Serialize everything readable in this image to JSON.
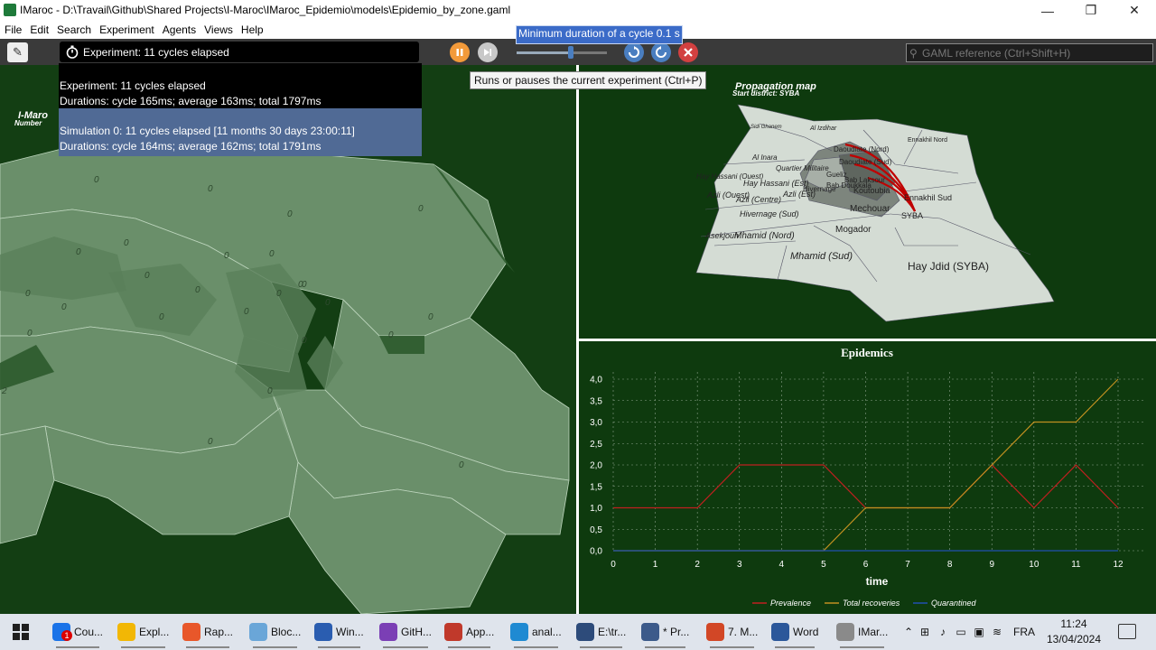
{
  "window": {
    "title": "IMaroc - D:\\Travail\\Github\\Shared Projects\\I-Maroc\\IMaroc_Epidemio\\models\\Epidemio_by_zone.gaml",
    "minimize": "—",
    "restore": "❐",
    "close": "✕"
  },
  "menu": [
    "File",
    "Edit",
    "Search",
    "Experiment",
    "Agents",
    "Views",
    "Help"
  ],
  "toolbar": {
    "experiment_status": "Experiment: 11 cycles elapsed",
    "slider_tooltip": "Minimum duration of a cycle 0.1 s",
    "slider_value": 0.6,
    "search_placeholder": "GAML reference (Ctrl+Shift+H)",
    "pause_tooltip": "Runs or pauses the current experiment (Ctrl+P)"
  },
  "status_dropdown": [
    {
      "line1": "Experiment: 11 cycles elapsed",
      "line2": "Durations: cycle 165ms; average 163ms; total 1797ms",
      "selected": false
    },
    {
      "line1": "Simulation 0: 11 cycles elapsed [11 months 30 days 23:00:11]",
      "line2": "Durations: cycle 164ms; average 162ms; total 1791ms",
      "selected": true
    }
  ],
  "left_view": {
    "title_fragment": "I-Maro",
    "subtitle_fragment": "Number",
    "zone_counts": [
      "0",
      "0",
      "0",
      "0",
      "0",
      "0",
      "0",
      "0",
      "0",
      "0",
      "0",
      "0",
      "0",
      "0",
      "0",
      "0",
      "0",
      "0",
      "0",
      "0",
      "0",
      "0",
      "2",
      "0",
      "0",
      "0"
    ]
  },
  "map": {
    "title": "Propagation map",
    "subtitle": "Start district: SYBA",
    "districts": [
      "Sidi Ghanem",
      "Al Izdihar",
      "Ennakhil Nord",
      "Daoudiate (Nord)",
      "Daoudiate (Sud)",
      "Al Inara",
      "Quartier Militaire",
      "Gueliz",
      "Hay Hassani (Ouest)",
      "Hay Hassani (Est)",
      "Bab Doukkala",
      "Bab Laksour",
      "Azli (Ouest)",
      "Azli (Est)",
      "Azli (Centre)",
      "Hivernage",
      "Koutoubia",
      "Ennakhil Sud",
      "Hivernage (Sud)",
      "Mechouar",
      "SYBA",
      "Asekjoun",
      "Mhamid (Nord)",
      "Mogador",
      "Mhamid (Sud)",
      "Hay Jdid (SYBA)"
    ]
  },
  "chart_data": {
    "type": "line",
    "title": "Epidemics",
    "xlabel": "time",
    "ylabel": "",
    "x": [
      0,
      1,
      2,
      3,
      4,
      5,
      6,
      7,
      8,
      9,
      10,
      11,
      12
    ],
    "xlim": [
      0,
      12
    ],
    "ylim": [
      0,
      4
    ],
    "yticks": [
      "0,0",
      "0,5",
      "1,0",
      "1,5",
      "2,0",
      "2,5",
      "3,0",
      "3,5",
      "4,0"
    ],
    "grid": true,
    "legend_position": "bottom",
    "series": [
      {
        "name": "Prevalence",
        "color": "#c02020",
        "values": [
          1,
          1,
          1,
          2,
          2,
          2,
          1,
          1,
          1,
          2,
          1,
          2,
          1
        ]
      },
      {
        "name": "Total recoveries",
        "color": "#c09020",
        "values": [
          0,
          0,
          0,
          0,
          0,
          0,
          1,
          1,
          1,
          2,
          3,
          3,
          4
        ]
      },
      {
        "name": "Quarantined",
        "color": "#2050b0",
        "values": [
          0,
          0,
          0,
          0,
          0,
          0,
          0,
          0,
          0,
          0,
          0,
          0,
          0
        ]
      }
    ]
  },
  "taskbar": {
    "apps": [
      {
        "label": "Cou...",
        "color": "#1a73e8",
        "badge": "1"
      },
      {
        "label": "Expl...",
        "color": "#f2b705"
      },
      {
        "label": "Rap...",
        "color": "#e8572a"
      },
      {
        "label": "Bloc...",
        "color": "#6aa6d8"
      },
      {
        "label": "Win...",
        "color": "#2a5db0"
      },
      {
        "label": "GitH...",
        "color": "#7b3fb5"
      },
      {
        "label": "App...",
        "color": "#c0392b"
      },
      {
        "label": "anal...",
        "color": "#1f8ad2"
      },
      {
        "label": "E:\\tr...",
        "color": "#2d4b7a"
      },
      {
        "label": "* Pr...",
        "color": "#3c5a8a"
      },
      {
        "label": "7. M...",
        "color": "#d24726"
      },
      {
        "label": "Word",
        "color": "#2b579a"
      },
      {
        "label": "IMar...",
        "color": "#8a8a8a"
      }
    ],
    "lang": "FRA",
    "time": "11:24",
    "date": "13/04/2024"
  }
}
